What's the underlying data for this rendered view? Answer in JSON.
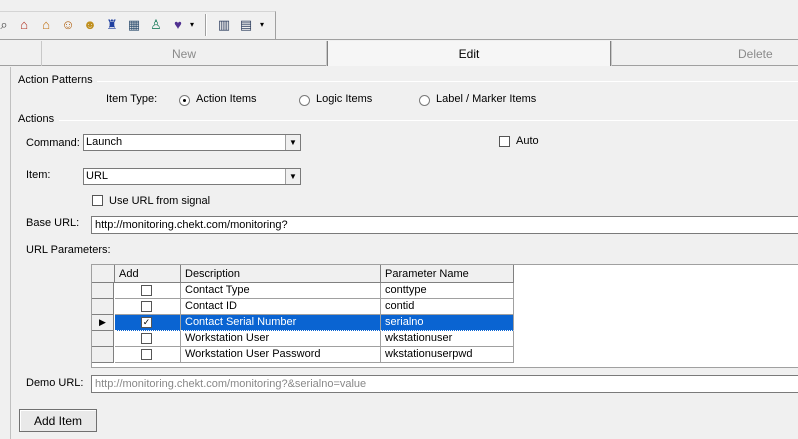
{
  "toolbar": {
    "icons": [
      {
        "name": "search-icon",
        "glyph": "⌕",
        "color": "#444"
      },
      {
        "name": "home-icon",
        "glyph": "⌂",
        "color": "#b03020"
      },
      {
        "name": "home-alert-icon",
        "glyph": "⌂",
        "color": "#c07010"
      },
      {
        "name": "people-icon",
        "glyph": "☺",
        "color": "#b06010"
      },
      {
        "name": "user-group-icon",
        "glyph": "☻",
        "color": "#c09020"
      },
      {
        "name": "robot-icon",
        "glyph": "♜",
        "color": "#2040a0"
      },
      {
        "name": "building-icon",
        "glyph": "▦",
        "color": "#305070"
      },
      {
        "name": "person-icon",
        "glyph": "♙",
        "color": "#208060"
      },
      {
        "name": "heart-icon",
        "glyph": "♥",
        "color": "#503090"
      },
      {
        "name": "book-icon",
        "glyph": "▥",
        "color": "#304060"
      },
      {
        "name": "report-icon",
        "glyph": "▤",
        "color": "#304060"
      }
    ]
  },
  "tabs": [
    {
      "label": "New",
      "state": "disabled"
    },
    {
      "label": "Edit",
      "state": "active"
    },
    {
      "label": "Delete",
      "state": "disabled"
    }
  ],
  "action_patterns": {
    "title": "Action Patterns",
    "item_type_label": "Item Type:",
    "options": [
      {
        "label": "Action Items",
        "checked": true
      },
      {
        "label": "Logic Items",
        "checked": false
      },
      {
        "label": "Label / Marker Items",
        "checked": false
      }
    ]
  },
  "actions": {
    "title": "Actions",
    "command_label": "Command:",
    "command_value": "Launch",
    "auto_label": "Auto",
    "auto_checked": false,
    "item_label": "Item:",
    "item_value": "URL",
    "use_url_label": "Use URL from signal",
    "use_url_checked": false,
    "base_url_label": "Base URL:",
    "base_url_value": "http://monitoring.chekt.com/monitoring?",
    "url_params_label": "URL Parameters:",
    "demo_url_label": "Demo URL:",
    "demo_url_value": "http://monitoring.chekt.com/monitoring?&serialno=value",
    "add_item_label": "Add Item"
  },
  "grid": {
    "columns": [
      "Add",
      "Description",
      "Parameter Name"
    ],
    "rows": [
      {
        "checked": false,
        "description": "Contact Type",
        "param": "conttype",
        "selected": false
      },
      {
        "checked": false,
        "description": "Contact ID",
        "param": "contid",
        "selected": false
      },
      {
        "checked": true,
        "description": "Contact Serial Number",
        "param": "serialno",
        "selected": true
      },
      {
        "checked": false,
        "description": "Workstation User",
        "param": "wkstationuser",
        "selected": false
      },
      {
        "checked": false,
        "description": "Workstation User Password",
        "param": "wkstationuserpwd",
        "selected": false
      }
    ]
  },
  "colors": {
    "selection": "#0a64d2",
    "background": "#f0f0f0"
  }
}
